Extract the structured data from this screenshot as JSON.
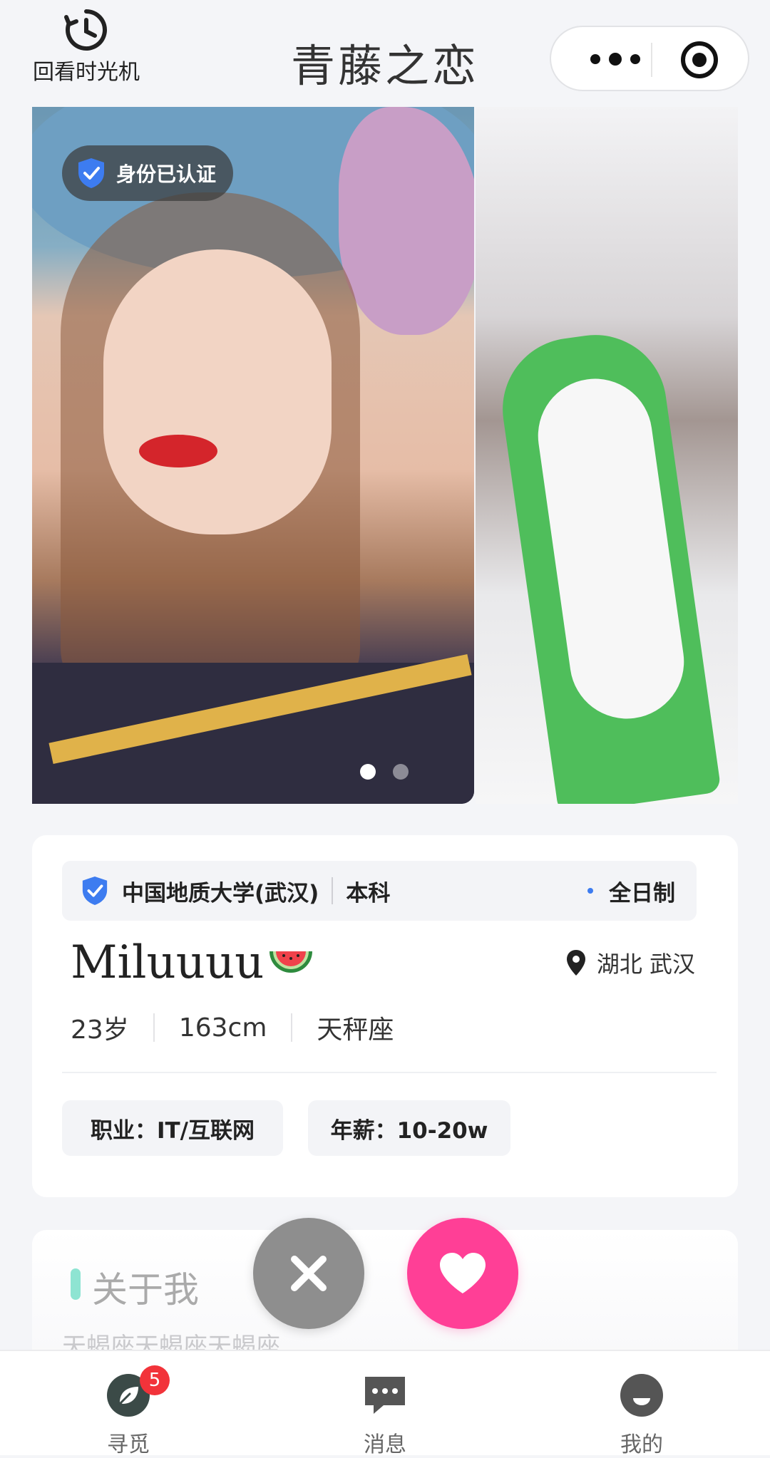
{
  "header": {
    "time_machine_label": "回看时光机",
    "time_machine_icon": "clock-rewind-icon",
    "title": "青藤之恋",
    "capsule": {
      "more_icon": "more-dots-icon",
      "target_icon": "target-icon"
    }
  },
  "carousel": {
    "verify_badge": "身份已认证",
    "photos": [
      "portrait-photo",
      "ski-photo"
    ],
    "active_index": 0,
    "total": 2
  },
  "profile": {
    "education": {
      "school": "中国地质大学(武汉)",
      "degree": "本科",
      "type": "全日制"
    },
    "name": "Miluuuu",
    "name_emoji": "watermelon-icon",
    "location": "湖北 武汉",
    "age": "23岁",
    "height": "163cm",
    "zodiac": "天秤座",
    "tags": {
      "job": "职业：IT/互联网",
      "salary": "年薪：10-20w"
    }
  },
  "about": {
    "title": "关于我",
    "text": "天蝎座天蝎座天蝎座"
  },
  "actions": {
    "dislike_icon": "close-icon",
    "like_icon": "heart-icon"
  },
  "tabbar": {
    "items": [
      {
        "label": "寻觅",
        "icon": "leaf-icon",
        "badge": "5"
      },
      {
        "label": "消息",
        "icon": "chat-bubble-icon"
      },
      {
        "label": "我的",
        "icon": "profile-face-icon"
      }
    ]
  },
  "colors": {
    "like": "#ff3f96",
    "dislike": "#8e8e8e",
    "verify_blue": "#3d7cf0",
    "badge_red": "#f2333a",
    "accent_teal": "#8ee4d2",
    "tab_active": "#3b4a47"
  }
}
